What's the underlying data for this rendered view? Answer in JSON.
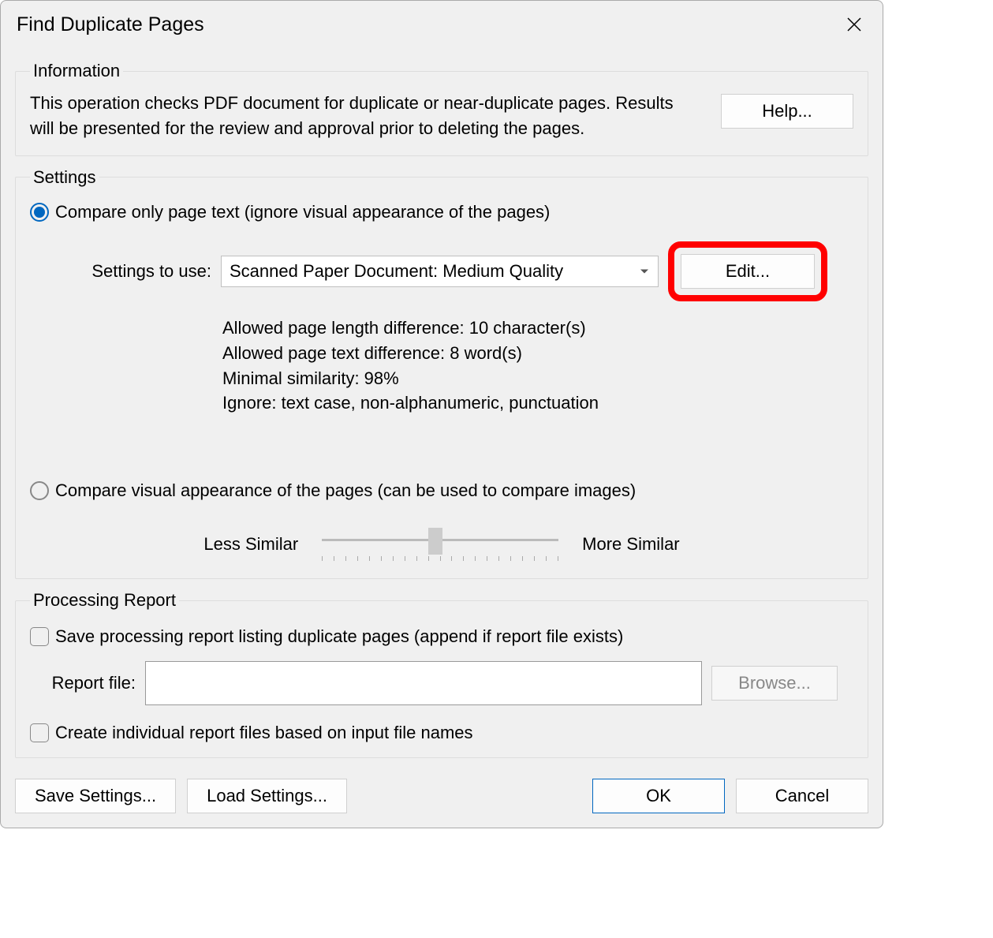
{
  "dialog": {
    "title": "Find Duplicate Pages"
  },
  "information": {
    "legend": "Information",
    "text": "This operation checks PDF document for duplicate or near-duplicate pages. Results will be presented for the review and approval prior to deleting the pages.",
    "help_button": "Help..."
  },
  "settings": {
    "legend": "Settings",
    "compare_text_radio": "Compare only page text (ignore visual appearance of the pages)",
    "settings_to_use_label": "Settings to use:",
    "dropdown_value": "Scanned Paper Document: Medium Quality",
    "edit_button": "Edit...",
    "detail_line1": "Allowed page length difference: 10 character(s)",
    "detail_line2": "Allowed page text difference: 8 word(s)",
    "detail_line3": "Minimal similarity: 98%",
    "detail_line4": "Ignore: text case, non-alphanumeric, punctuation",
    "compare_visual_radio": "Compare visual appearance of the pages (can be used to compare images)",
    "less_similar": "Less Similar",
    "more_similar": "More Similar"
  },
  "report": {
    "legend": "Processing Report",
    "save_report_checkbox": "Save processing report listing duplicate pages (append if report file exists)",
    "report_file_label": "Report file:",
    "report_file_value": "",
    "browse_button": "Browse...",
    "create_individual_checkbox": "Create individual report files based on input file names"
  },
  "footer": {
    "save_settings": "Save Settings...",
    "load_settings": "Load Settings...",
    "ok": "OK",
    "cancel": "Cancel"
  }
}
